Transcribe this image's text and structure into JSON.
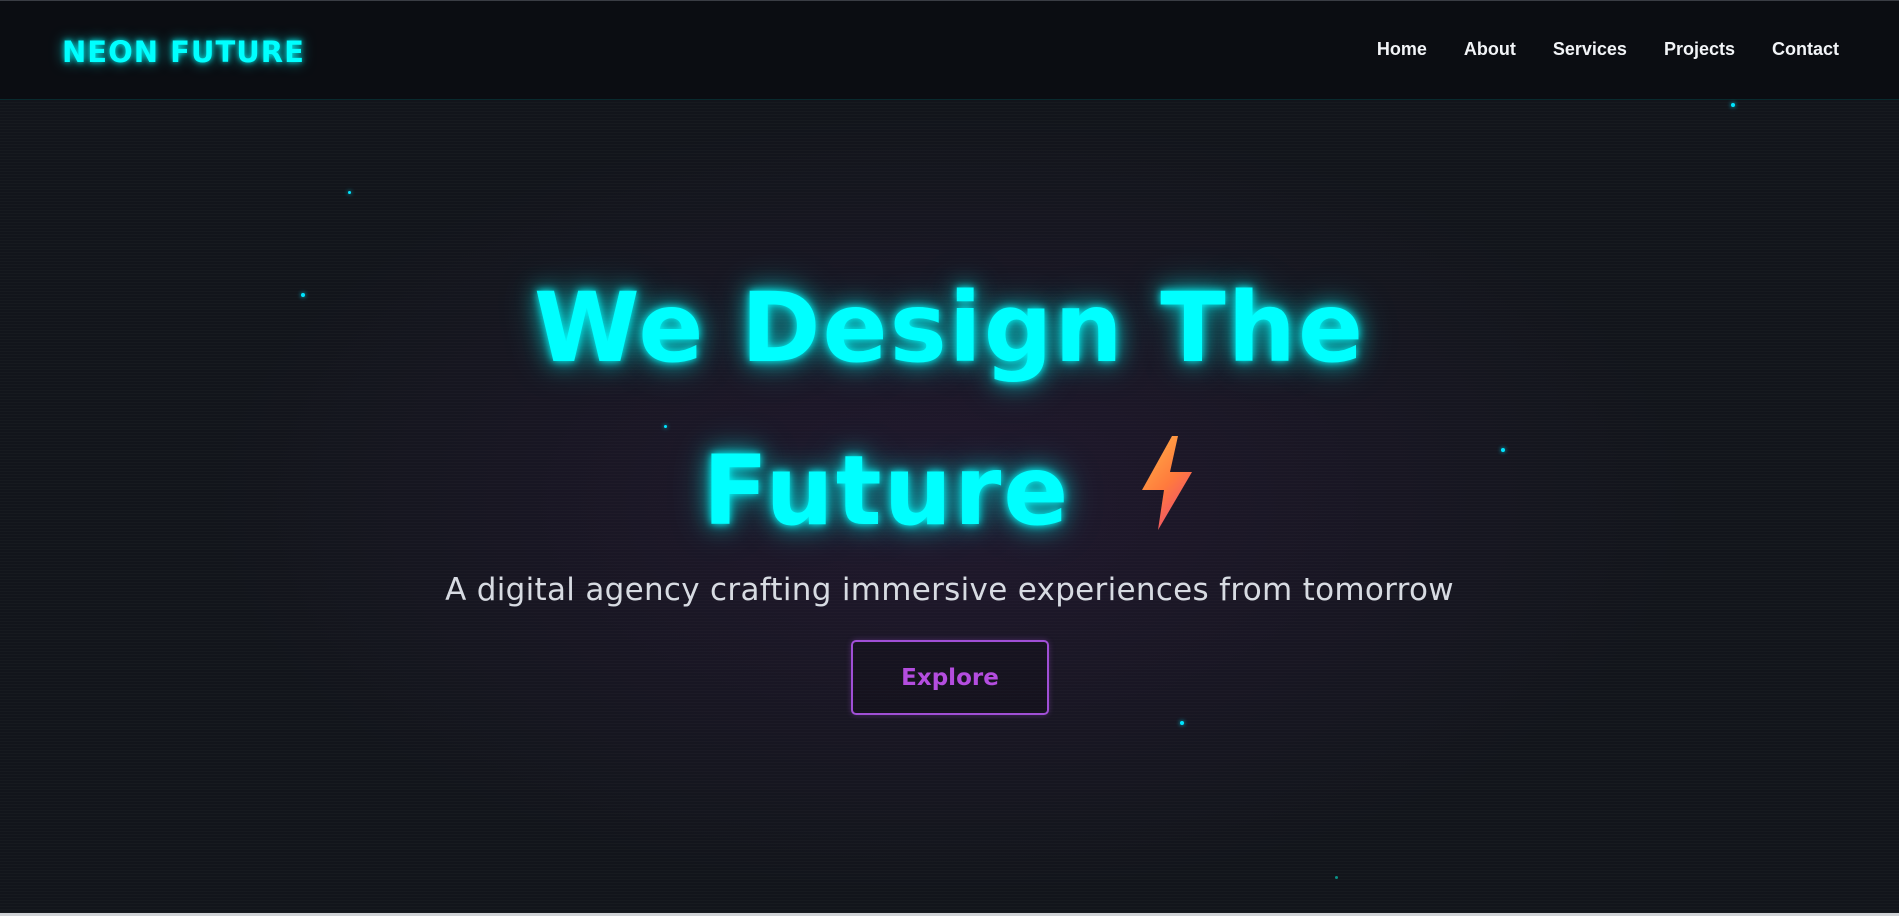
{
  "brand": {
    "logo_text": "NEON FUTURE",
    "accent_color": "#00ffff",
    "button_color": "#a04fd6"
  },
  "nav": {
    "items": [
      {
        "label": "Home"
      },
      {
        "label": "About"
      },
      {
        "label": "Services"
      },
      {
        "label": "Projects"
      },
      {
        "label": "Contact"
      }
    ]
  },
  "hero": {
    "title_line1": "We Design The",
    "title_line2": "Future",
    "title_icon": "lightning-bolt-icon",
    "subtitle": "A digital agency crafting immersive experiences from tomorrow",
    "cta_label": "Explore"
  }
}
